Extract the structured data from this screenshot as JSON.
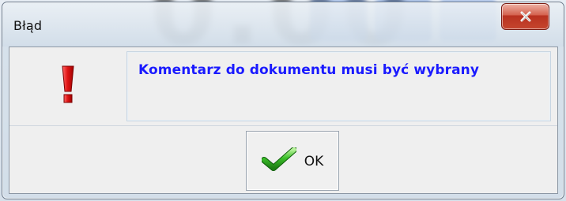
{
  "dialog": {
    "title": "Błąd",
    "message": "Komentarz do dokumentu musi być wybrany",
    "ok_label": "OK"
  },
  "icons": {
    "error": "exclamation-icon",
    "ok": "checkmark-icon",
    "close": "close-icon"
  },
  "colors": {
    "message": "#1a1aff",
    "error_icon": "#e01616",
    "checkmark": "#2aa01a",
    "close_button": "#c5452e"
  }
}
